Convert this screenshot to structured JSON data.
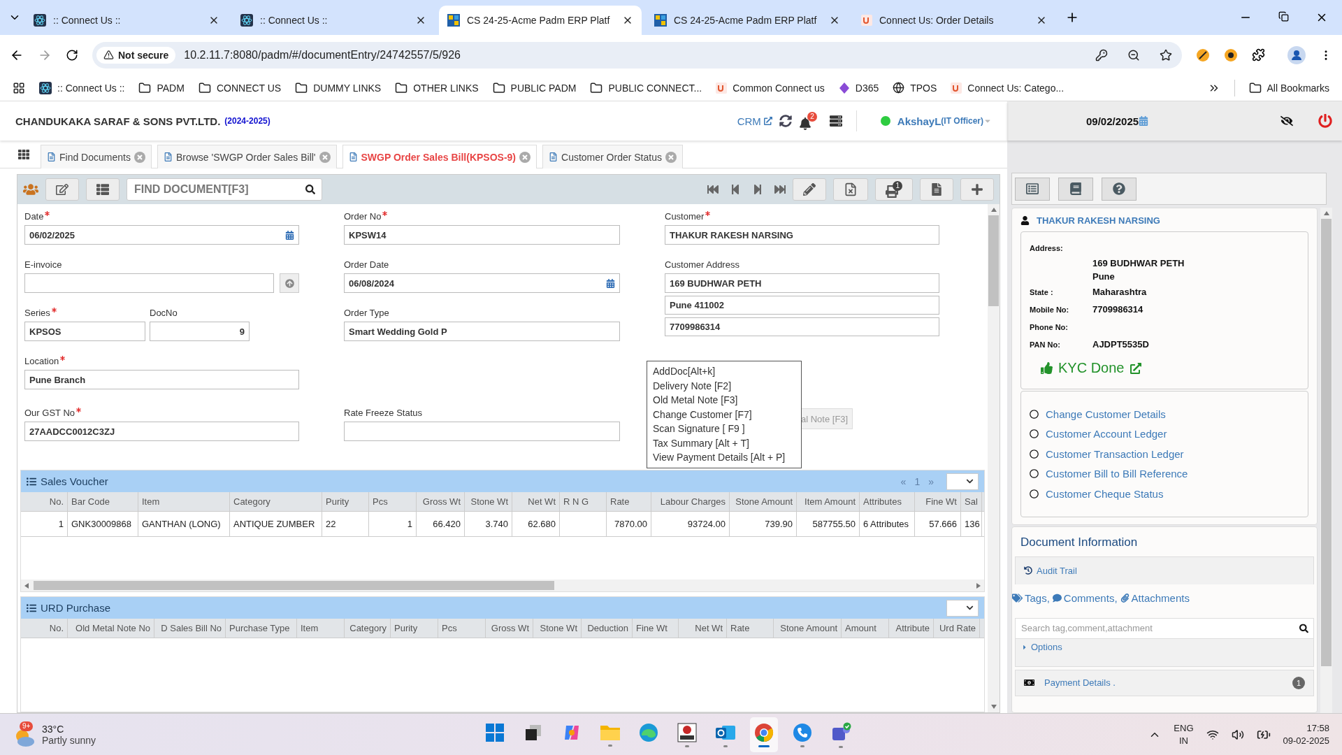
{
  "browser": {
    "tabs": [
      {
        "title": ":: Connect Us ::",
        "kind": "connect",
        "selected": false
      },
      {
        "title": ":: Connect Us ::",
        "kind": "connect",
        "selected": false
      },
      {
        "title": "CS 24-25-Acme Padm ERP Platf",
        "kind": "erp",
        "selected": true
      },
      {
        "title": "CS 24-25-Acme Padm ERP Platf",
        "kind": "erp",
        "selected": false
      },
      {
        "title": "Connect Us: Order Details",
        "kind": "site",
        "selected": false
      }
    ],
    "security": "Not secure",
    "url": "10.2.11.7:8080/padm/#/documentEntry/24742557/5/926",
    "bookmarks": [
      {
        "label": ":: Connect Us ::",
        "kind": "connect"
      },
      {
        "label": "PADM",
        "kind": "folder"
      },
      {
        "label": "CONNECT US",
        "kind": "folder"
      },
      {
        "label": "DUMMY LINKS",
        "kind": "folder"
      },
      {
        "label": "OTHER LINKS",
        "kind": "folder"
      },
      {
        "label": "PUBLIC PADM",
        "kind": "folder"
      },
      {
        "label": "PUBLIC CONNECT...",
        "kind": "folder"
      },
      {
        "label": "Common Connect us",
        "kind": "site"
      },
      {
        "label": "D365",
        "kind": "diamond"
      },
      {
        "label": "TPOS",
        "kind": "globe"
      },
      {
        "label": "Connect Us: Catego...",
        "kind": "site"
      }
    ],
    "all_bookmarks": "All Bookmarks"
  },
  "header": {
    "company": "CHANDUKAKA SARAF & SONS PVT.LTD.",
    "year": "(2024-2025)",
    "crm": "CRM",
    "notifications": "2",
    "user": "AkshayL",
    "role": "(IT Officer)"
  },
  "doc_tabs": [
    {
      "label": "Find Documents",
      "selected": false
    },
    {
      "label": "Browse 'SWGP Order Sales Bill'",
      "selected": false
    },
    {
      "label": "SWGP Order Sales Bill(KPSOS-9)",
      "selected": true
    },
    {
      "label": "Customer Order Status",
      "selected": false
    }
  ],
  "toolbar": {
    "search_placeholder": "FIND DOCUMENT[F3]",
    "print_badge": "1"
  },
  "form": {
    "date": {
      "label": "Date",
      "required": true,
      "value": "06/02/2025"
    },
    "e_invoice": {
      "label": "E-invoice",
      "required": false
    },
    "series": {
      "label": "Series",
      "required": true,
      "value": "KPSOS"
    },
    "doc_no": {
      "label": "DocNo",
      "required": false,
      "value": "9"
    },
    "location": {
      "label": "Location",
      "required": true,
      "value": "Pune Branch"
    },
    "gst_no": {
      "label": "Our GST No",
      "required": true,
      "value": "27AADCC0012C3ZJ"
    },
    "order_no": {
      "label": "Order No",
      "required": true,
      "value": "KPSW14"
    },
    "order_date": {
      "label": "Order Date",
      "required": false,
      "value": "06/08/2024"
    },
    "order_type": {
      "label": "Order Type",
      "required": false,
      "value": "Smart Wedding Gold P"
    },
    "rate_freeze_status": {
      "label": "Rate Freeze Status",
      "required": false
    },
    "customer": {
      "label": "Customer",
      "required": true,
      "value": "THAKUR RAKESH NARSING"
    },
    "customer_address": {
      "label": "Customer Address",
      "required": false,
      "lines": [
        "169 BUDHWAR PETH",
        "Pune 411002",
        "7709986314"
      ]
    }
  },
  "hidden_button": "al Note [F3]",
  "context_menu": [
    "AddDoc[Alt+k]",
    "Delivery Note [F2]",
    "Old Metal Note [F3]",
    "Change Customer [F7]",
    "Scan Signature [ F9 ]",
    "Tax Summary [Alt + T]",
    "View Payment Details [Alt + P]"
  ],
  "sales_voucher": {
    "title": "Sales Voucher",
    "pager": [
      "«",
      "1",
      "»"
    ],
    "columns": [
      "No.",
      "Bar Code",
      "Item",
      "Category",
      "Purity",
      "Pcs",
      "Gross Wt",
      "Stone Wt",
      "Net Wt",
      "R N G",
      "Rate",
      "Labour Charges",
      "Stone Amount",
      "Item Amount",
      "Attributes",
      "Fine Wt",
      "Sal"
    ],
    "rows": [
      [
        "1",
        "GNK30009868",
        "GANTHAN (LONG)",
        "ANTIQUE ZUMBER",
        "22",
        "1",
        "66.420",
        "3.740",
        "62.680",
        "",
        "7870.00",
        "93724.00",
        "739.90",
        "587755.50",
        "6 Attributes",
        "57.666",
        "136"
      ]
    ]
  },
  "urd_purchase": {
    "title": "URD Purchase",
    "columns": [
      "No.",
      "Old Metal Note No",
      "D Sales Bill No",
      "Purchase Type",
      "Item",
      "Category",
      "Purity",
      "Pcs",
      "Gross Wt",
      "Stone Wt",
      "Deduction",
      "Fine Wt",
      "Net Wt",
      "Rate",
      "Stone Amount",
      "Amount",
      "Attribute",
      "Urd Rate"
    ]
  },
  "side_panel": {
    "date": "09/02/2025",
    "customer_name": "THAKUR RAKESH NARSING",
    "details": [
      {
        "label": "Address:",
        "values": [
          "169 BUDHWAR PETH",
          "Pune"
        ]
      },
      {
        "label": "State :",
        "values": [
          "Maharashtra"
        ]
      },
      {
        "label": "Mobile No:",
        "values": [
          "7709986314"
        ]
      },
      {
        "label": "Phone No:"
      },
      {
        "label": "PAN No:",
        "values": [
          "AJDPT5535D"
        ]
      }
    ],
    "kyc": "KYC Done",
    "links": [
      "Change Customer Details",
      "Customer Account Ledger",
      "Customer Transaction Ledger",
      "Customer Bill to Bill Reference",
      "Customer Cheque Status"
    ],
    "document_information": "Document Information",
    "audit_trail": "Audit Trail",
    "tags": "Tags,",
    "comments": "Comments,",
    "attachments": "Attachments",
    "search_placeholder": "Search tag,comment,attachment",
    "options": "Options",
    "payment_details": "Payment Details .",
    "payment_count": "1"
  },
  "taskbar": {
    "weather_badge": "9+",
    "temperature": "33°C",
    "weather": "Partly sunny",
    "apps": [
      {
        "kind": "start",
        "running": false,
        "active": false
      },
      {
        "kind": "taskview",
        "running": false,
        "active": false
      },
      {
        "kind": "copilot",
        "running": false,
        "active": false
      },
      {
        "kind": "explorer",
        "running": true,
        "active": false
      },
      {
        "kind": "edge",
        "running": false,
        "active": false
      },
      {
        "kind": "vnc",
        "running": true,
        "active": false
      },
      {
        "kind": "outlook",
        "running": true,
        "active": false
      },
      {
        "kind": "chrome",
        "running": true,
        "active": true
      },
      {
        "kind": "phone",
        "running": true,
        "active": false
      },
      {
        "kind": "teams",
        "running": true,
        "active": false
      }
    ],
    "language": "ENG",
    "region": "IN",
    "time": "17:58",
    "date": "09-02-2025"
  }
}
